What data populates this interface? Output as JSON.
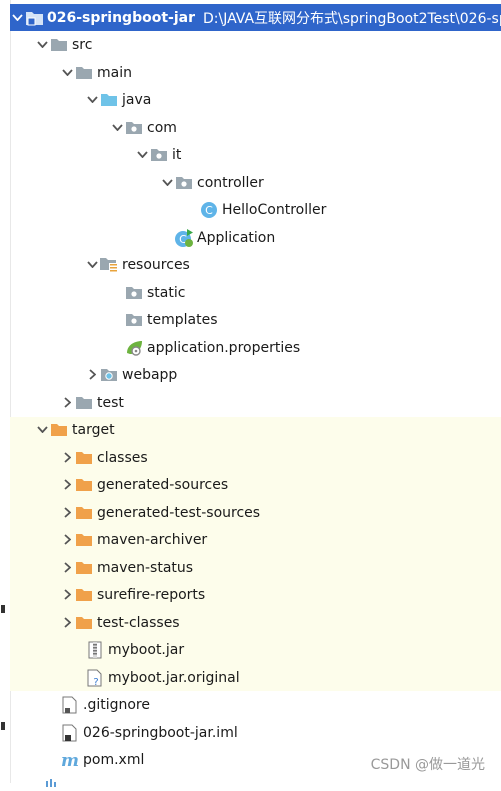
{
  "root": {
    "name": "026-springboot-jar",
    "path": "D:\\JAVA互联网分布式\\springBoot2Test\\026-spr"
  },
  "nodes": {
    "src": "src",
    "main": "main",
    "java": "java",
    "com": "com",
    "it": "it",
    "controller": "controller",
    "hello_controller": "HelloController",
    "application": "Application",
    "resources": "resources",
    "static": "static",
    "templates": "templates",
    "application_properties": "application.properties",
    "webapp": "webapp",
    "test": "test",
    "target": "target",
    "classes": "classes",
    "generated_sources": "generated-sources",
    "generated_test_sources": "generated-test-sources",
    "maven_archiver": "maven-archiver",
    "maven_status": "maven-status",
    "surefire_reports": "surefire-reports",
    "test_classes": "test-classes",
    "myboot_jar": "myboot.jar",
    "myboot_jar_original": "myboot.jar.original",
    "gitignore": ".gitignore",
    "iml": "026-springboot-jar.iml",
    "pom": "pom.xml"
  },
  "watermark": "CSDN @做一道光",
  "colors": {
    "selection": "#2f65ca",
    "excluded_folder": "#f0a14a",
    "target_highlight": "#fdfdeb",
    "folder_gray": "#9aa7b0",
    "source_folder": "#6fc3e8"
  },
  "icons": {
    "folder": "folder-icon",
    "module": "module-icon",
    "source_folder": "source-folder-icon",
    "package": "package-icon",
    "class": "class-icon",
    "spring_boot_app": "spring-boot-app-icon",
    "resources_folder": "resources-folder-icon",
    "properties": "spring-properties-icon",
    "web_folder": "web-folder-icon",
    "excluded_folder": "excluded-folder-icon",
    "jar": "jar-file-icon",
    "unknown_file": "unknown-file-icon",
    "text_file": "text-file-icon",
    "maven": "maven-icon"
  }
}
